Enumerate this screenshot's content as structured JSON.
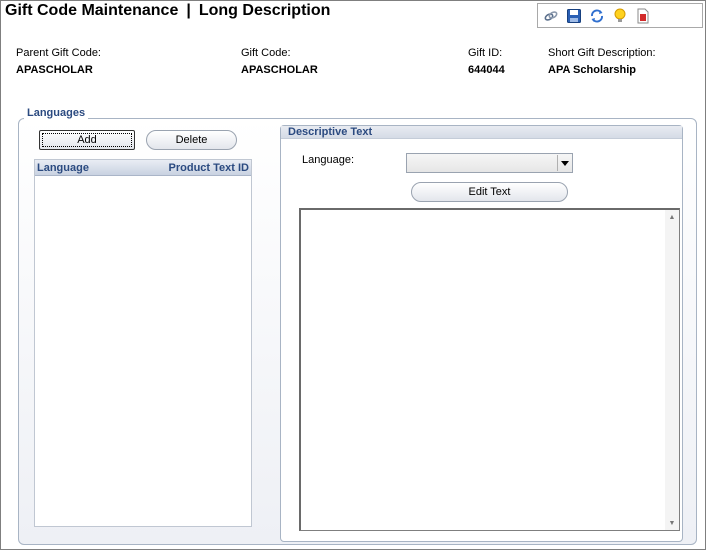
{
  "header": {
    "title_left": "Gift Code Maintenance",
    "separator": "|",
    "title_right": "Long Description"
  },
  "toolbar": {
    "icons": [
      "link-icon",
      "save-icon",
      "refresh-icon",
      "lightbulb-icon",
      "document-icon"
    ]
  },
  "info": {
    "parent_gift_code_label": "Parent Gift Code:",
    "parent_gift_code_value": "APASCHOLAR",
    "gift_code_label": "Gift Code:",
    "gift_code_value": "APASCHOLAR",
    "gift_id_label": "Gift ID:",
    "gift_id_value": "644044",
    "short_desc_label": "Short Gift Description:",
    "short_desc_value": "APA Scholarship"
  },
  "languages": {
    "legend": "Languages",
    "add_label": "Add",
    "delete_label": "Delete",
    "columns": [
      "Language",
      "Product Text ID"
    ]
  },
  "descriptive": {
    "title": "Descriptive Text",
    "language_label": "Language:",
    "language_value": "",
    "edit_text_label": "Edit Text"
  },
  "colors": {
    "accent_text": "#2b4a80",
    "border": "#a8b4c4"
  }
}
